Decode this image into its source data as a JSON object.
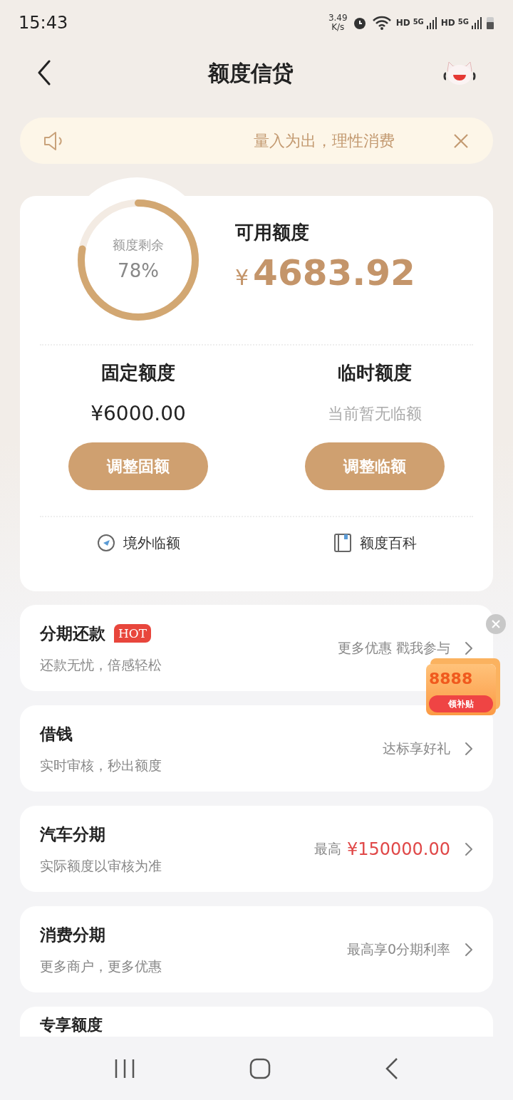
{
  "status_bar": {
    "time": "15:43",
    "speed_value": "3.49",
    "speed_unit": "K/s",
    "hd_labels": [
      "HD",
      "HD"
    ],
    "network_labels": [
      "5G",
      "5G"
    ]
  },
  "header": {
    "title": "额度信贷"
  },
  "notice": {
    "text": "量入为出，理性消费"
  },
  "credit": {
    "ring_label": "额度剩余",
    "ring_percent": "78%",
    "available_label": "可用额度",
    "currency": "¥",
    "available_amount": "4683.92",
    "columns": [
      {
        "title": "固定额度",
        "value": "¥6000.00",
        "muted": false,
        "button": "调整固额"
      },
      {
        "title": "临时额度",
        "value": "当前暂无临额",
        "muted": true,
        "button": "调整临额"
      }
    ],
    "links": [
      {
        "kind": "overseas",
        "label": "境外临额"
      },
      {
        "kind": "wiki",
        "label": "额度百科"
      }
    ]
  },
  "services": [
    {
      "title": "分期还款",
      "badge": "HOT",
      "subtitle": "还款无忧，倍感轻松",
      "promo": "更多优惠 戳我参与",
      "highlight": false
    },
    {
      "title": "借钱",
      "subtitle": "实时审核，秒出额度",
      "promo": "达标享好礼",
      "highlight": false
    },
    {
      "title": "汽车分期",
      "subtitle": "实际额度以审核为准",
      "prefix": "最高",
      "promo": "¥150000.00",
      "highlight": true
    },
    {
      "title": "消费分期",
      "subtitle": "更多商户，更多优惠",
      "promo": "最高享0分期利率",
      "highlight": false
    }
  ],
  "partial_service": {
    "title": "专享额度"
  },
  "coupon": {
    "amount": "8888",
    "action": "领补贴"
  }
}
